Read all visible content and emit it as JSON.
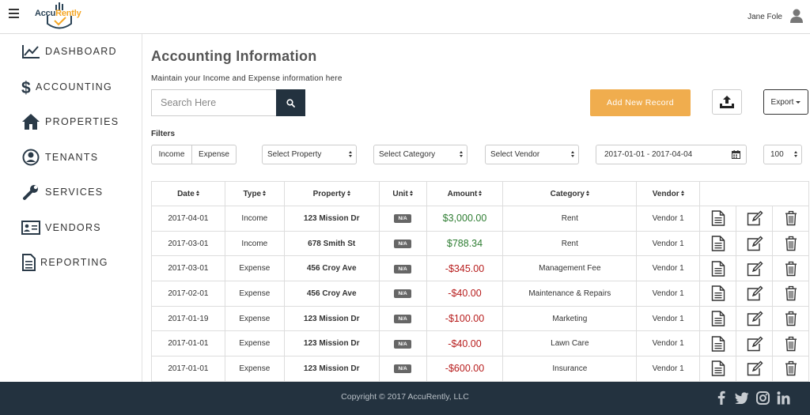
{
  "header": {
    "logo_prefix": "Accu",
    "logo_suffix": "Rently",
    "user_name": "Jane Fole"
  },
  "sidebar": {
    "items": [
      {
        "label": "DASHBOARD",
        "icon": "chart-line-icon"
      },
      {
        "label": "ACCOUNTING",
        "icon": "dollar-icon"
      },
      {
        "label": "PROPERTIES",
        "icon": "home-icon"
      },
      {
        "label": "TENANTS",
        "icon": "user-circle-icon"
      },
      {
        "label": "SERVICES",
        "icon": "wrench-icon"
      },
      {
        "label": "VENDORS",
        "icon": "id-card-icon"
      },
      {
        "label": "REPORTING",
        "icon": "document-icon"
      }
    ]
  },
  "main": {
    "title": "Accounting Information",
    "subtitle": "Maintain your Income and Expense information here",
    "search": {
      "placeholder": "Search Here"
    },
    "add_button": "Add New Record",
    "export_button": "Export",
    "filters_label": "Filters",
    "type_filters": [
      "Income",
      "Expense"
    ],
    "property_select": "Select Property",
    "category_select": "Select Category",
    "vendor_select": "Select Vendor",
    "date_range": "2017-01-01 - 2017-04-04",
    "page_size": "100"
  },
  "table": {
    "columns": [
      "Date",
      "Type",
      "Property",
      "Unit",
      "Amount",
      "Category",
      "Vendor"
    ],
    "rows": [
      {
        "date": "2017-04-01",
        "type": "Income",
        "property": "123 Mission Dr",
        "unit": "N/A",
        "amount": "$3,000.00",
        "sign": "pos",
        "category": "Rent",
        "vendor": "Vendor 1"
      },
      {
        "date": "2017-03-01",
        "type": "Income",
        "property": "678 Smith St",
        "unit": "N/A",
        "amount": "$788.34",
        "sign": "pos",
        "category": "Rent",
        "vendor": "Vendor 1"
      },
      {
        "date": "2017-03-01",
        "type": "Expense",
        "property": "456 Croy Ave",
        "unit": "N/A",
        "amount": "-$345.00",
        "sign": "neg",
        "category": "Management Fee",
        "vendor": "Vendor 1"
      },
      {
        "date": "2017-02-01",
        "type": "Expense",
        "property": "456 Croy Ave",
        "unit": "N/A",
        "amount": "-$40.00",
        "sign": "neg",
        "category": "Maintenance & Repairs",
        "vendor": "Vendor 1"
      },
      {
        "date": "2017-01-19",
        "type": "Expense",
        "property": "123 Mission Dr",
        "unit": "N/A",
        "amount": "-$100.00",
        "sign": "neg",
        "category": "Marketing",
        "vendor": "Vendor 1"
      },
      {
        "date": "2017-01-01",
        "type": "Expense",
        "property": "123 Mission Dr",
        "unit": "N/A",
        "amount": "-$40.00",
        "sign": "neg",
        "category": "Lawn Care",
        "vendor": "Vendor 1"
      },
      {
        "date": "2017-01-01",
        "type": "Expense",
        "property": "123 Mission Dr",
        "unit": "N/A",
        "amount": "-$600.00",
        "sign": "neg",
        "category": "Insurance",
        "vendor": "Vendor 1"
      }
    ]
  },
  "footer": {
    "copyright": "Copyright © 2017 AccuRently, LLC",
    "social": [
      "facebook-icon",
      "twitter-icon",
      "instagram-icon",
      "linkedin-icon"
    ]
  },
  "colors": {
    "accent": "#f0ad4e",
    "dark": "#23323f",
    "positive": "#2e7d32",
    "negative": "#b71c1c"
  }
}
